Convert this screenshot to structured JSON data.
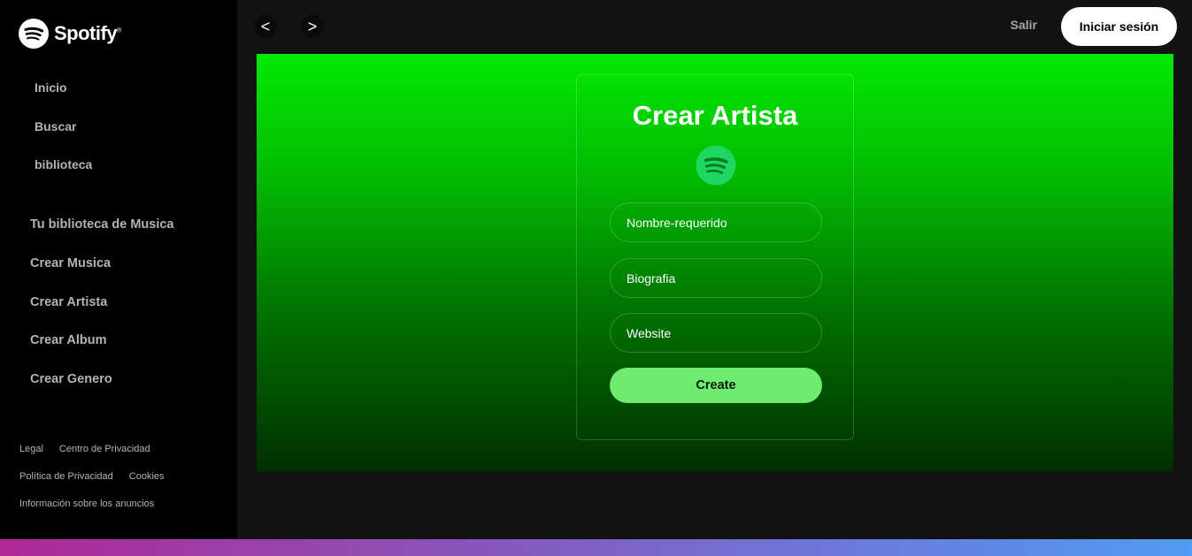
{
  "brand": {
    "name": "Spotify",
    "mark": "®"
  },
  "nav": {
    "items": [
      {
        "label": "Inicio"
      },
      {
        "label": "Buscar"
      },
      {
        "label": "biblioteca"
      }
    ]
  },
  "library": {
    "items": [
      {
        "label": "Tu biblioteca de Musica"
      },
      {
        "label": "Crear Musica"
      },
      {
        "label": "Crear Artista"
      },
      {
        "label": "Crear Album"
      },
      {
        "label": "Crear Genero"
      }
    ]
  },
  "footer": {
    "legal": "Legal",
    "privacy_center": "Centro de Privacidad",
    "privacy_policy": "Política de Privacidad",
    "cookies": "Cookies",
    "ads_info": "Información sobre los anuncios"
  },
  "topbar": {
    "back_icon": "<",
    "forward_icon": ">",
    "logout_label": "Salir",
    "login_label": "Iniciar sesión"
  },
  "form": {
    "title": "Crear Artista",
    "name_placeholder": "Nombre-requerido",
    "bio_placeholder": "Biografia",
    "website_placeholder": "Website",
    "submit_label": "Create"
  },
  "colors": {
    "accent": "#1ed760",
    "hero_top": "#03ea03",
    "hero_bottom": "#002f00",
    "create_button": "#6fec6f"
  }
}
